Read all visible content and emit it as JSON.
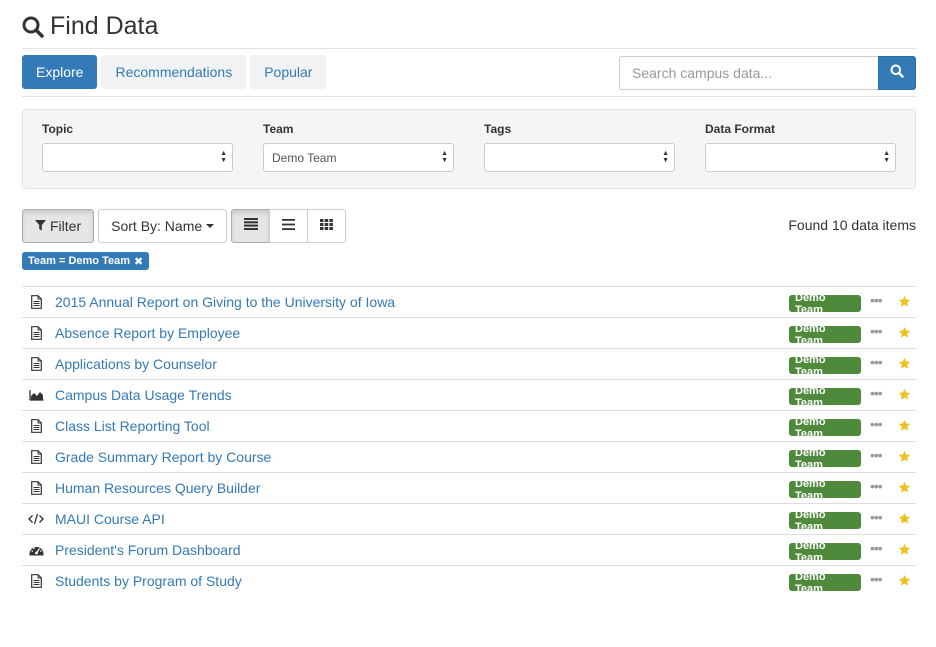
{
  "page": {
    "title": "Find Data"
  },
  "tabs": [
    {
      "label": "Explore",
      "active": true
    },
    {
      "label": "Recommendations",
      "active": false
    },
    {
      "label": "Popular",
      "active": false
    }
  ],
  "search": {
    "placeholder": "Search campus data...",
    "value": ""
  },
  "filters": [
    {
      "label": "Topic",
      "value": ""
    },
    {
      "label": "Team",
      "value": "Demo Team"
    },
    {
      "label": "Tags",
      "value": ""
    },
    {
      "label": "Data Format",
      "value": ""
    }
  ],
  "toolbar": {
    "filter_label": "Filter",
    "sort_label": "Sort By: Name",
    "views": [
      "view-detailed-icon",
      "view-list-icon",
      "view-grid-icon"
    ],
    "found_text": "Found 10 data items"
  },
  "active_filter": {
    "label": "Team = Demo Team",
    "remove_icon": "close-icon"
  },
  "results": [
    {
      "icon": "document-icon",
      "title": "2015 Annual Report on Giving to the University of Iowa",
      "badge": "Demo Team"
    },
    {
      "icon": "document-icon",
      "title": "Absence Report by Employee",
      "badge": "Demo Team"
    },
    {
      "icon": "document-icon",
      "title": "Applications by Counselor",
      "badge": "Demo Team"
    },
    {
      "icon": "area-chart-icon",
      "title": "Campus Data Usage Trends",
      "badge": "Demo Team"
    },
    {
      "icon": "document-icon",
      "title": "Class List Reporting Tool",
      "badge": "Demo Team"
    },
    {
      "icon": "document-icon",
      "title": "Grade Summary Report by Course",
      "badge": "Demo Team"
    },
    {
      "icon": "document-icon",
      "title": "Human Resources Query Builder",
      "badge": "Demo Team"
    },
    {
      "icon": "code-icon",
      "title": "MAUI Course API",
      "badge": "Demo Team"
    },
    {
      "icon": "dashboard-icon",
      "title": "President's Forum Dashboard",
      "badge": "Demo Team"
    },
    {
      "icon": "document-icon",
      "title": "Students by Program of Study",
      "badge": "Demo Team"
    }
  ],
  "colors": {
    "primary": "#337ab7",
    "badge": "#4f8a3c",
    "star": "#f0c020"
  }
}
